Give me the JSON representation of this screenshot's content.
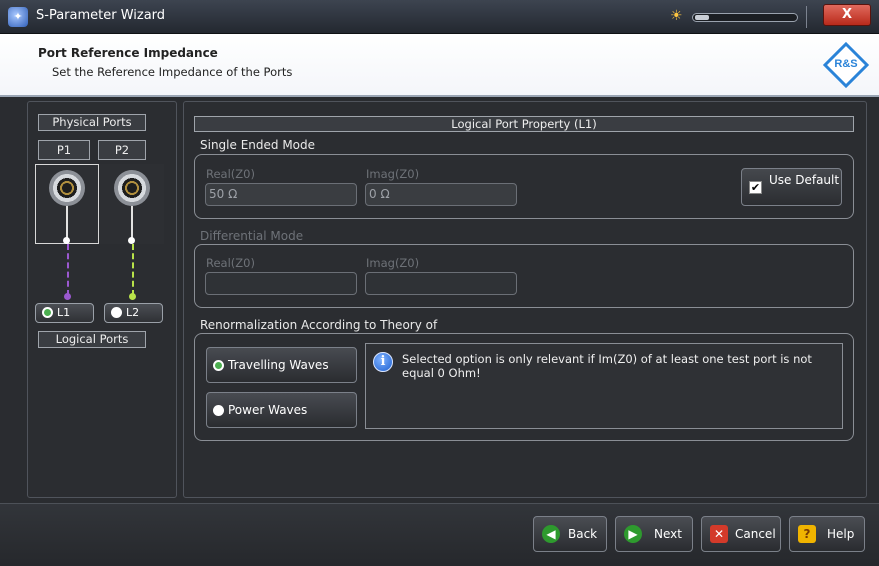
{
  "window": {
    "title": "S-Parameter Wizard",
    "close_label": "X",
    "brightness_icon": "sun-icon"
  },
  "header": {
    "title": "Port Reference Impedance",
    "subtitle": "Set the Reference Impedance of the Ports",
    "logo_text": "R&S"
  },
  "physical": {
    "title": "Physical Ports",
    "ports": [
      "P1",
      "P2"
    ],
    "logical_title": "Logical Ports",
    "logical_ports": [
      {
        "label": "L1",
        "selected": true,
        "dot_color": "#4caf50",
        "line_color": "#9b59d0"
      },
      {
        "label": "L2",
        "selected": false,
        "dot_color": "#ffffff",
        "line_color": "#b9e34a"
      }
    ]
  },
  "property": {
    "title": "Logical Port Property (L1)",
    "single_ended": {
      "title": "Single Ended Mode",
      "real_label": "Real(Z0)",
      "real_value": "50 Ω",
      "imag_label": "Imag(Z0)",
      "imag_value": "0 Ω",
      "use_default_label": "Use Default",
      "use_default_checked": true
    },
    "differential": {
      "title": "Differential Mode",
      "real_label": "Real(Z0)",
      "real_value": "",
      "imag_label": "Imag(Z0)",
      "imag_value": ""
    },
    "renorm": {
      "title": "Renormalization According to Theory of",
      "options": [
        "Travelling Waves",
        "Power Waves"
      ],
      "selected": "Travelling Waves",
      "info_text": "Selected option is only relevant if Im(Z0) of at least one test port is not equal 0 Ohm!"
    }
  },
  "buttons": {
    "back": "Back",
    "next": "Next",
    "cancel": "Cancel",
    "help": "Help"
  },
  "colors": {
    "accent_green": "#4caf50",
    "back_next_icon": "#2e9a2e",
    "cancel_icon": "#d33a2a",
    "help_icon": "#f0b400"
  }
}
